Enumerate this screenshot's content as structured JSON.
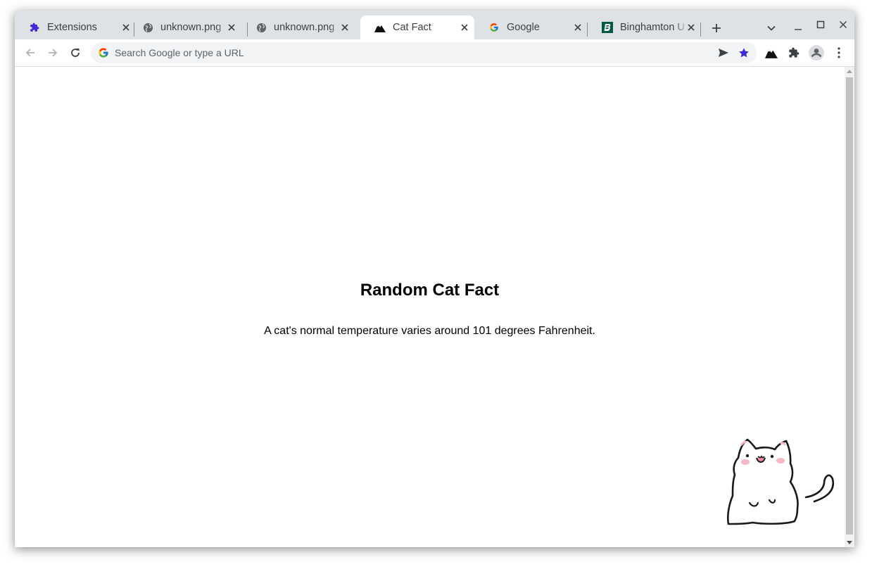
{
  "browser": {
    "tabs": [
      {
        "title": "Extensions",
        "favicon": "puzzle-icon",
        "active": false
      },
      {
        "title": "unknown.png",
        "favicon": "globe-icon",
        "active": false
      },
      {
        "title": "unknown.png",
        "favicon": "globe-icon",
        "active": false
      },
      {
        "title": "Cat Fact",
        "favicon": "mountain-icon",
        "active": true
      },
      {
        "title": "Google",
        "favicon": "google-icon",
        "active": false
      },
      {
        "title": "Binghamton U",
        "favicon": "binghamton-icon",
        "active": false
      }
    ],
    "omnibox": {
      "placeholder": "Search Google or type a URL"
    },
    "accent_color": "#3c2bd6"
  },
  "page": {
    "heading": "Random Cat Fact",
    "fact": "A cat's normal temperature varies around 101 degrees Fahrenheit."
  }
}
